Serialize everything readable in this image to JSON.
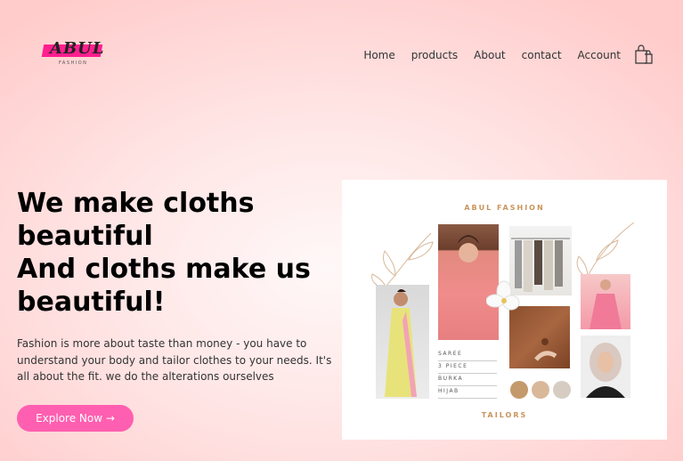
{
  "brand": {
    "name": "ABUL",
    "sub": "FASHION"
  },
  "nav": {
    "items": [
      "Home",
      "products",
      "About",
      "contact",
      "Account"
    ]
  },
  "hero": {
    "title_lines": [
      "We make cloths",
      "beautiful",
      "And cloths make us",
      "beautiful!"
    ],
    "description": "Fashion is more about taste than money - you have to understand your body and tailor clothes to your needs. It's all about the fit. we do the alterations ourselves",
    "cta": "Explore Now →"
  },
  "moodboard": {
    "title": "ABUL FASHION",
    "tags": [
      "SAREE",
      "3 PIECE",
      "BURKA",
      "HIJAB"
    ],
    "footer": "TAILORS",
    "swatches": [
      "#c49a6c",
      "#d9b89a",
      "#d6ccc2"
    ]
  },
  "colors": {
    "accent": "#ff5fb0",
    "logo_bar": "#ff1f8f",
    "board_text": "#c8955c"
  },
  "icons": {
    "cart": "shopping-bag-icon"
  }
}
